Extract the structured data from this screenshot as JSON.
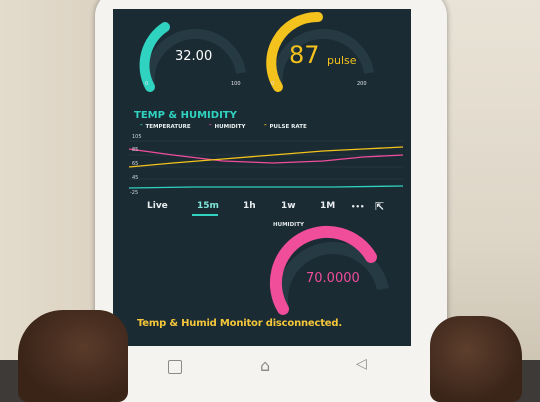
{
  "gauge_left": {
    "value": "32.00",
    "min": "0",
    "max": "100",
    "color": "#2fd3c0"
  },
  "gauge_right": {
    "value": "87",
    "unit": "pulse",
    "min": "0",
    "max": "200",
    "color": "#f4c21c"
  },
  "chart_title": "TEMP & HUMIDITY",
  "legend": [
    "TEMPERATURE",
    "HUMIDITY",
    "PULSE RATE"
  ],
  "y_ticks": [
    "105",
    "85",
    "65",
    "45",
    "25",
    "-25"
  ],
  "tabs": [
    "Live",
    "15m",
    "1h",
    "1w",
    "1M",
    "•••"
  ],
  "humidity_label": "HUMIDITY",
  "gauge_bottom": {
    "value": "70.0000",
    "color": "#f04d9a"
  },
  "status_text": "Temp & Humid Monitor disconnected.",
  "colors": {
    "screen_bg": "#1b2b34",
    "accent": "#2fd3c0",
    "warning": "#f4c63a"
  }
}
